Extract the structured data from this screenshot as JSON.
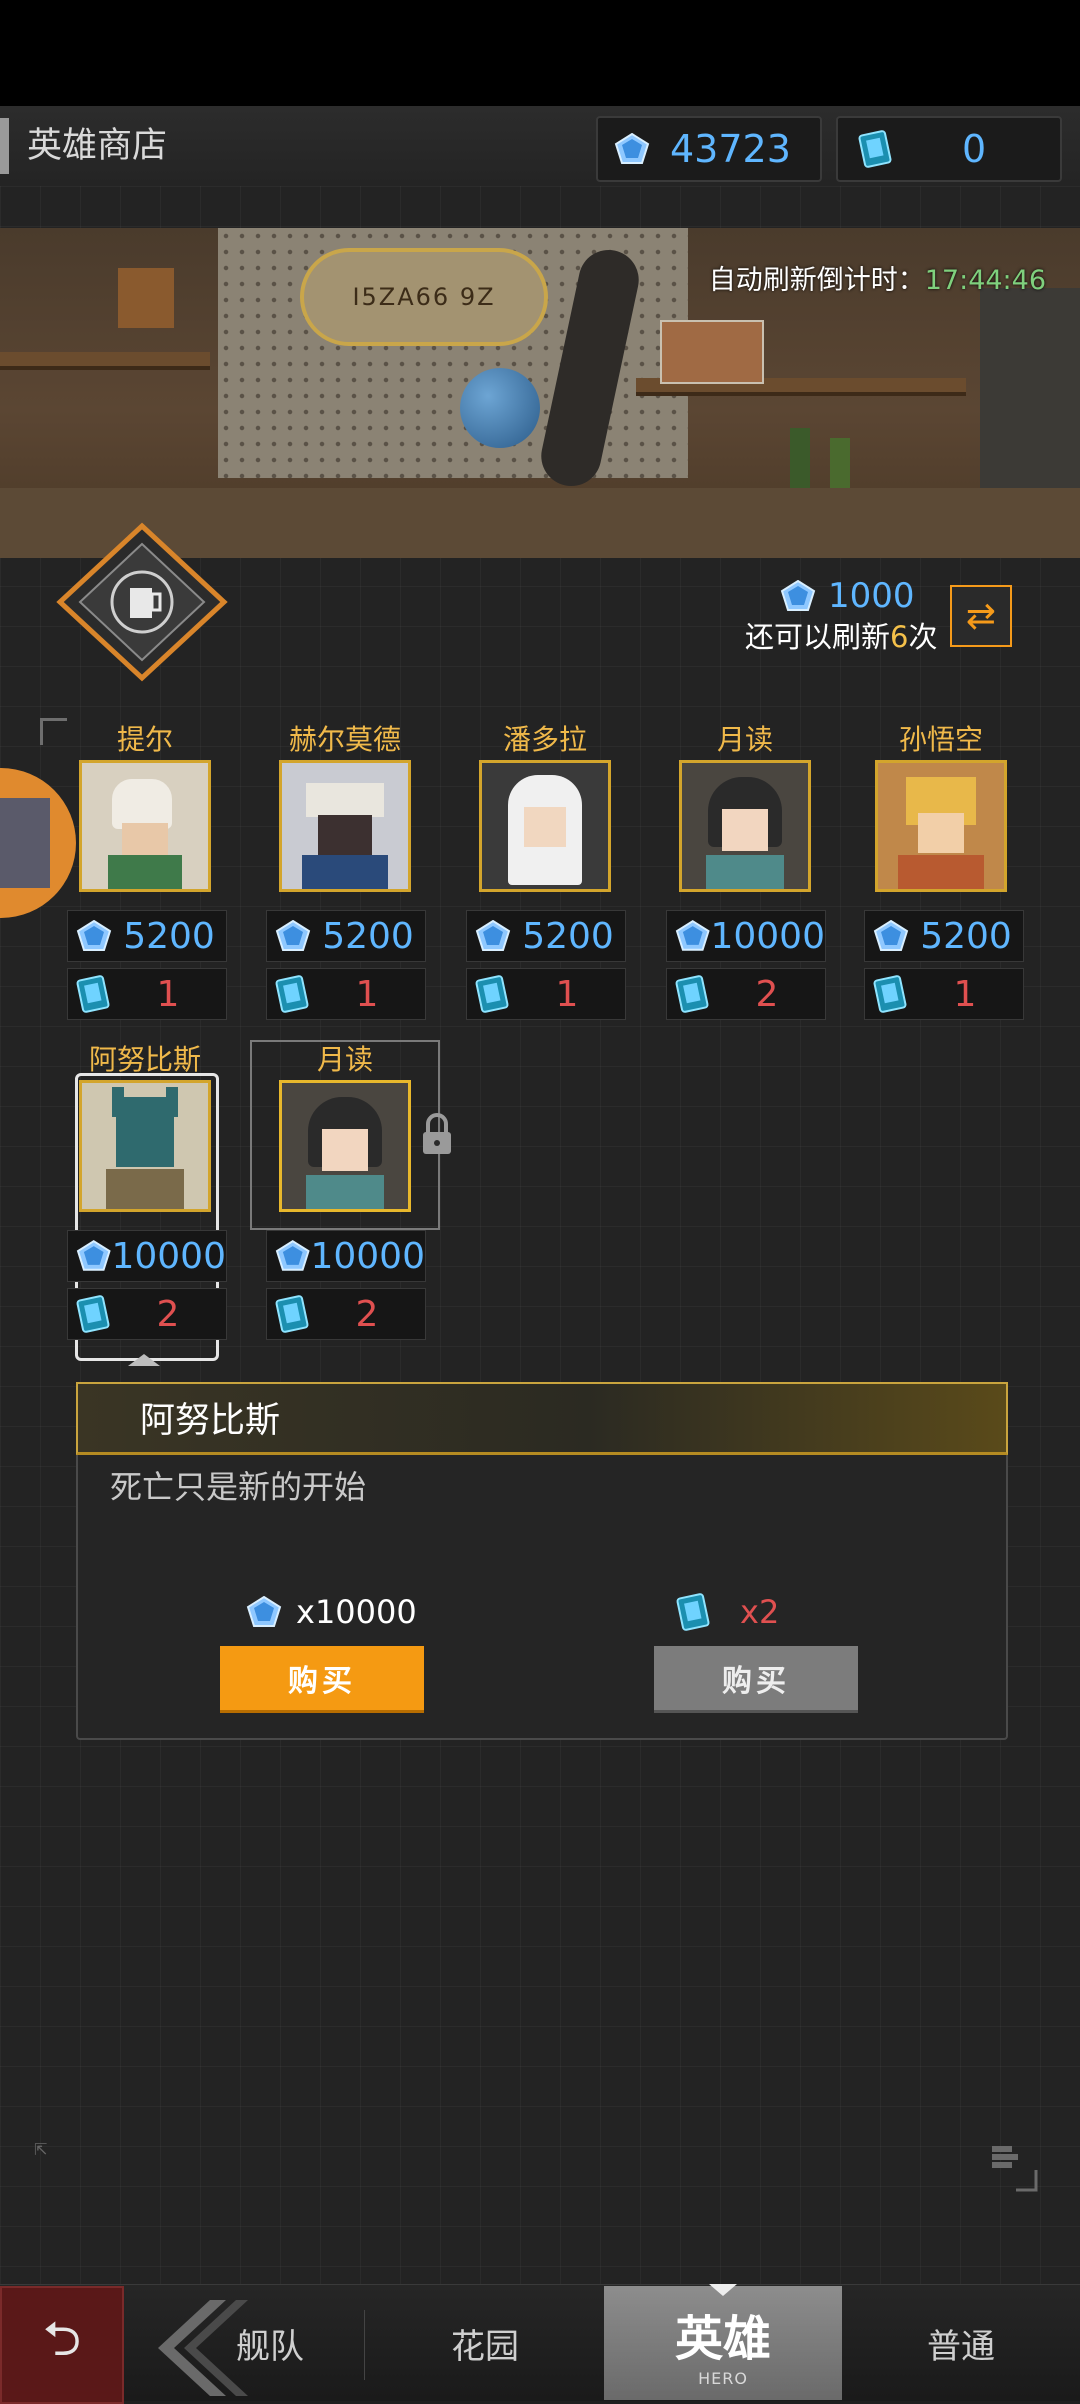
{
  "header": {
    "title": "英雄商店",
    "gems": "43723",
    "scrolls": "0"
  },
  "shop": {
    "refresh_timer_label": "自动刷新倒计时：",
    "refresh_timer_value": "17:44:46",
    "refresh_cost": "1000",
    "refresh_left_prefix": "还可以刷新",
    "refresh_left_count": "6",
    "refresh_left_suffix": "次",
    "sign_text": "I5ZA66 9Z"
  },
  "heroes": [
    {
      "name": "提尔",
      "gem_price": "5200",
      "scroll_price": "1"
    },
    {
      "name": "赫尔莫德",
      "gem_price": "5200",
      "scroll_price": "1"
    },
    {
      "name": "潘多拉",
      "gem_price": "5200",
      "scroll_price": "1"
    },
    {
      "name": "月读",
      "gem_price": "10000",
      "scroll_price": "2"
    },
    {
      "name": "孙悟空",
      "gem_price": "5200",
      "scroll_price": "1"
    },
    {
      "name": "阿努比斯",
      "gem_price": "10000",
      "scroll_price": "2"
    },
    {
      "name": "月读",
      "gem_price": "10000",
      "scroll_price": "2"
    }
  ],
  "detail": {
    "name": "阿努比斯",
    "description": "死亡只是新的开始",
    "gem_cost": "x10000",
    "scroll_cost": "x2",
    "buy_gem_label": "购买",
    "buy_scroll_label": "购买"
  },
  "tabs": {
    "fleet": "舰队",
    "garden": "花园",
    "hero": "英雄",
    "hero_sub": "HERO",
    "normal": "普通"
  },
  "colors": {
    "accent_orange": "#f59a12",
    "gem_blue": "#5fb6ff",
    "scroll_red": "#e05050",
    "hero_name_gold": "#f0b94a",
    "timer_green": "#7fd07d"
  }
}
